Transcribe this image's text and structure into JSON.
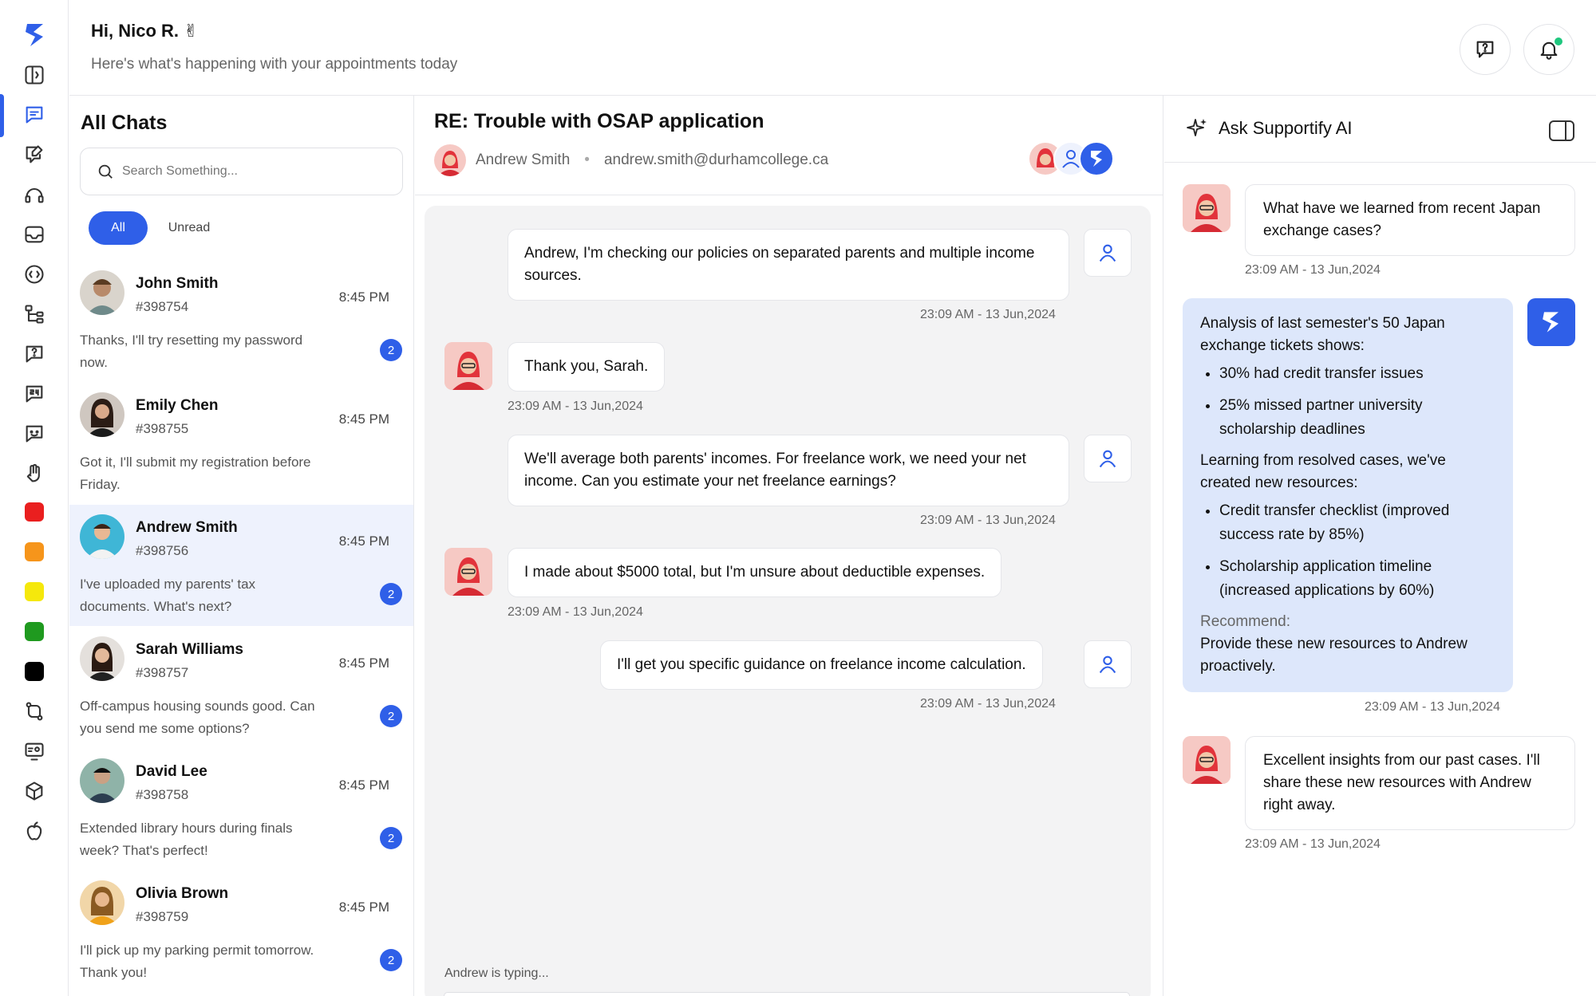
{
  "header": {
    "greeting": "Hi, Nico R. ✌",
    "subtitle": "Here's what's happening with your appointments today"
  },
  "chat_list": {
    "title": "All Chats",
    "search_placeholder": "Search Something...",
    "filters": [
      "All",
      "Unread"
    ],
    "chats": [
      {
        "name": "John Smith",
        "id": "#398754",
        "time": "8:45 PM",
        "message": "Thanks, I'll try resetting my password now.",
        "badge": "2"
      },
      {
        "name": "Emily Chen",
        "id": "#398755",
        "time": "8:45 PM",
        "message": "Got it, I'll submit my registration before Friday."
      },
      {
        "name": "Andrew Smith",
        "id": "#398756",
        "time": "8:45 PM",
        "message": " I've uploaded my parents' tax documents. What's next?",
        "badge": "2"
      },
      {
        "name": "Sarah Williams",
        "id": "#398757",
        "time": "8:45 PM",
        "message": "Off-campus housing sounds good. Can you send me some options?",
        "badge": "2"
      },
      {
        "name": "David Lee",
        "id": "#398758",
        "time": "8:45 PM",
        "message": "Extended library hours during finals week? That's perfect!",
        "badge": "2"
      },
      {
        "name": "Olivia Brown",
        "id": "#398759",
        "time": "8:45 PM",
        "message": "I'll pick up my parking permit tomorrow. Thank you!",
        "badge": "2"
      }
    ]
  },
  "conversation": {
    "title": "RE: Trouble with OSAP application",
    "contact_name": "Andrew Smith",
    "contact_email": "andrew.smith@durhamcollege.ca",
    "separator": "•",
    "messages": [
      {
        "text": "Andrew, I'm checking our policies on separated parents and multiple income sources.",
        "time": "23:09 AM - 13 Jun,2024"
      },
      {
        "text": "Thank you, Sarah.",
        "time": "23:09 AM - 13 Jun,2024"
      },
      {
        "text": "We'll average both parents' incomes. For freelance work, we need your net income. Can you estimate your net freelance earnings?",
        "time": "23:09 AM - 13 Jun,2024"
      },
      {
        "text": "I made about $5000 total, but I'm unsure about deductible expenses.",
        "time": "23:09 AM - 13 Jun,2024"
      },
      {
        "text": "I'll get you specific guidance on freelance income calculation.",
        "time": "23:09 AM - 13 Jun,2024"
      }
    ],
    "typing": "Andrew is typing..."
  },
  "ai_panel": {
    "title": "Ask Supportify AI",
    "question": "What have we learned from recent Japan exchange cases?",
    "question_time": "23:09 AM - 13 Jun,2024",
    "response": {
      "intro": "Analysis of last semester's 50 Japan exchange tickets shows:",
      "bullets1": [
        "30% had credit transfer issues",
        "25% missed partner university scholarship deadlines"
      ],
      "mid": "Learning from resolved cases, we've created new resources:",
      "bullets2": [
        "Credit transfer checklist (improved success rate by 85%)",
        "Scholarship application timeline (increased applications by 60%)"
      ],
      "recommend_label": "Recommend:",
      "recommend_text": "Provide these new resources to Andrew proactively."
    },
    "response_time": "23:09 AM - 13 Jun,2024",
    "followup": "Excellent insights from our past cases. I'll share these new resources with Andrew right away.",
    "followup_time": "23:09 AM - 13 Jun,2024"
  },
  "colors": {
    "accent": "#2f5fe8",
    "selected_row": "#eef2fd",
    "ai_bubble": "#dde7fb"
  },
  "rail": {
    "icons": [
      "sidebar-toggle-icon",
      "chat-icon",
      "chat-edit-icon",
      "headset-icon",
      "inbox-icon",
      "code-icon",
      "hierarchy-icon",
      "help-chat-icon",
      "24h-icon",
      "bot-chat-icon",
      "hand-icon",
      "git-compare-icon",
      "screen-user-icon",
      "cube-icon",
      "apple-icon"
    ],
    "status_colors": [
      "#ea1f1f",
      "#f6951b",
      "#f5e80c",
      "#1f9a1f",
      "#000000"
    ]
  }
}
